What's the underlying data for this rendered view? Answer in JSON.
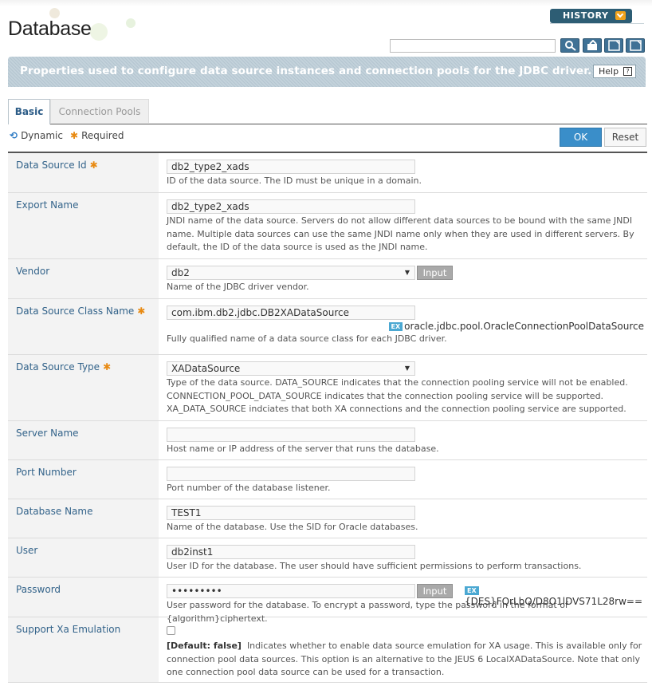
{
  "header": {
    "title": "Database",
    "history_label": "HISTORY",
    "search_value": "",
    "banner_text": "Properties used to configure data source instances and connection pools for the JDBC driver.",
    "help_label": "Help",
    "help_icon": "?"
  },
  "tabs": [
    {
      "label": "Basic",
      "active": true
    },
    {
      "label": "Connection Pools",
      "active": false
    }
  ],
  "legend": {
    "dynamic": "Dynamic",
    "required": "Required"
  },
  "actions": {
    "ok": "OK",
    "reset": "Reset"
  },
  "colors": {
    "accent": "#3a8ec9",
    "label": "#33638a",
    "required": "#e88a12",
    "banner": "#bccbd5"
  },
  "icons": {
    "dynamic": "refresh-icon",
    "required": "asterisk-icon",
    "search": "search-icon",
    "toolbar": [
      "search-icon",
      "export-icon",
      "xml-icon",
      "xml-icon"
    ]
  },
  "fields": {
    "data_source_id": {
      "label": "Data Source Id",
      "value": "db2_type2_xads",
      "desc": "ID of the data source. The ID must be unique in a domain."
    },
    "export_name": {
      "label": "Export Name",
      "value": "db2_type2_xads",
      "desc": "JNDI name of the data source. Servers do not allow different data sources to be bound with the same JNDI name. Multiple data sources can use the same JNDI name only when they are used in different servers. By default, the ID of the data source is used as the JNDI name."
    },
    "vendor": {
      "label": "Vendor",
      "value": "db2",
      "button": "Input",
      "desc": "Name of the JDBC driver vendor."
    },
    "data_source_class_name": {
      "label": "Data Source Class Name",
      "value": "com.ibm.db2.jdbc.DB2XADataSource",
      "ex_label": "EX",
      "example": "oracle.jdbc.pool.OracleConnectionPoolDataSource",
      "desc": "Fully qualified name of a data source class for each JDBC driver."
    },
    "data_source_type": {
      "label": "Data Source Type",
      "value": "XADataSource",
      "desc": "Type of the data source. DATA_SOURCE indicates that the connection pooling service will not be enabled. CONNECTION_POOL_DATA_SOURCE indicates that the connection pooling service will be supported. XA_DATA_SOURCE indciates that both XA connections and the connection pooling service are supported."
    },
    "server_name": {
      "label": "Server Name",
      "value": "",
      "desc": "Host name or IP address of the server that runs the database."
    },
    "port_number": {
      "label": "Port Number",
      "value": "",
      "desc": "Port number of the database listener."
    },
    "database_name": {
      "label": "Database Name",
      "value": "TEST1",
      "desc": "Name of the database. Use the SID for Oracle databases."
    },
    "user": {
      "label": "User",
      "value": "db2inst1",
      "desc": "User ID for the database. The user should have sufficient permissions to perform transactions."
    },
    "password": {
      "label": "Password",
      "value": "•••••••••",
      "button": "Input",
      "ex_label": "EX",
      "example": "{DES}FQrLbQ/D8O1lDVS71L28rw==",
      "desc": "User password for the database. To encrypt a password, type the password in the format of {algorithm}ciphertext."
    },
    "support_xa_emulation": {
      "label": "Support Xa Emulation",
      "default": "[Default: false]",
      "desc": "Indicates whether to enable data source emulation for XA usage. This is available only for connection pool data sources. This option is an alternative to the JEUS 6 LocalXADataSource. Note that only one connection pool data source can be used for a transaction."
    }
  }
}
